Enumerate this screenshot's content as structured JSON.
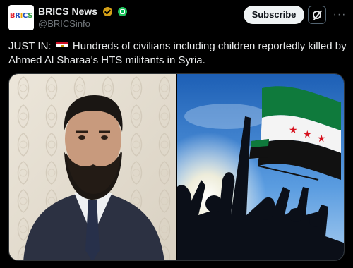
{
  "account": {
    "avatar_text": "BRICS",
    "display_name": "BRICS News",
    "handle": "@BRICSinfo"
  },
  "actions": {
    "subscribe_label": "Subscribe",
    "more_label": "···"
  },
  "post": {
    "prefix": "JUST IN:",
    "body": "Hundreds of civilians including children reportedly killed by Ahmed Al Sharaa's HTS militants in Syria."
  },
  "colors": {
    "background": "#000000",
    "text": "#e7e9ea",
    "muted": "#71767b",
    "gold_badge": "#d4a017",
    "green_badge": "#22c55e",
    "subscribe_bg": "#eff3f4"
  }
}
